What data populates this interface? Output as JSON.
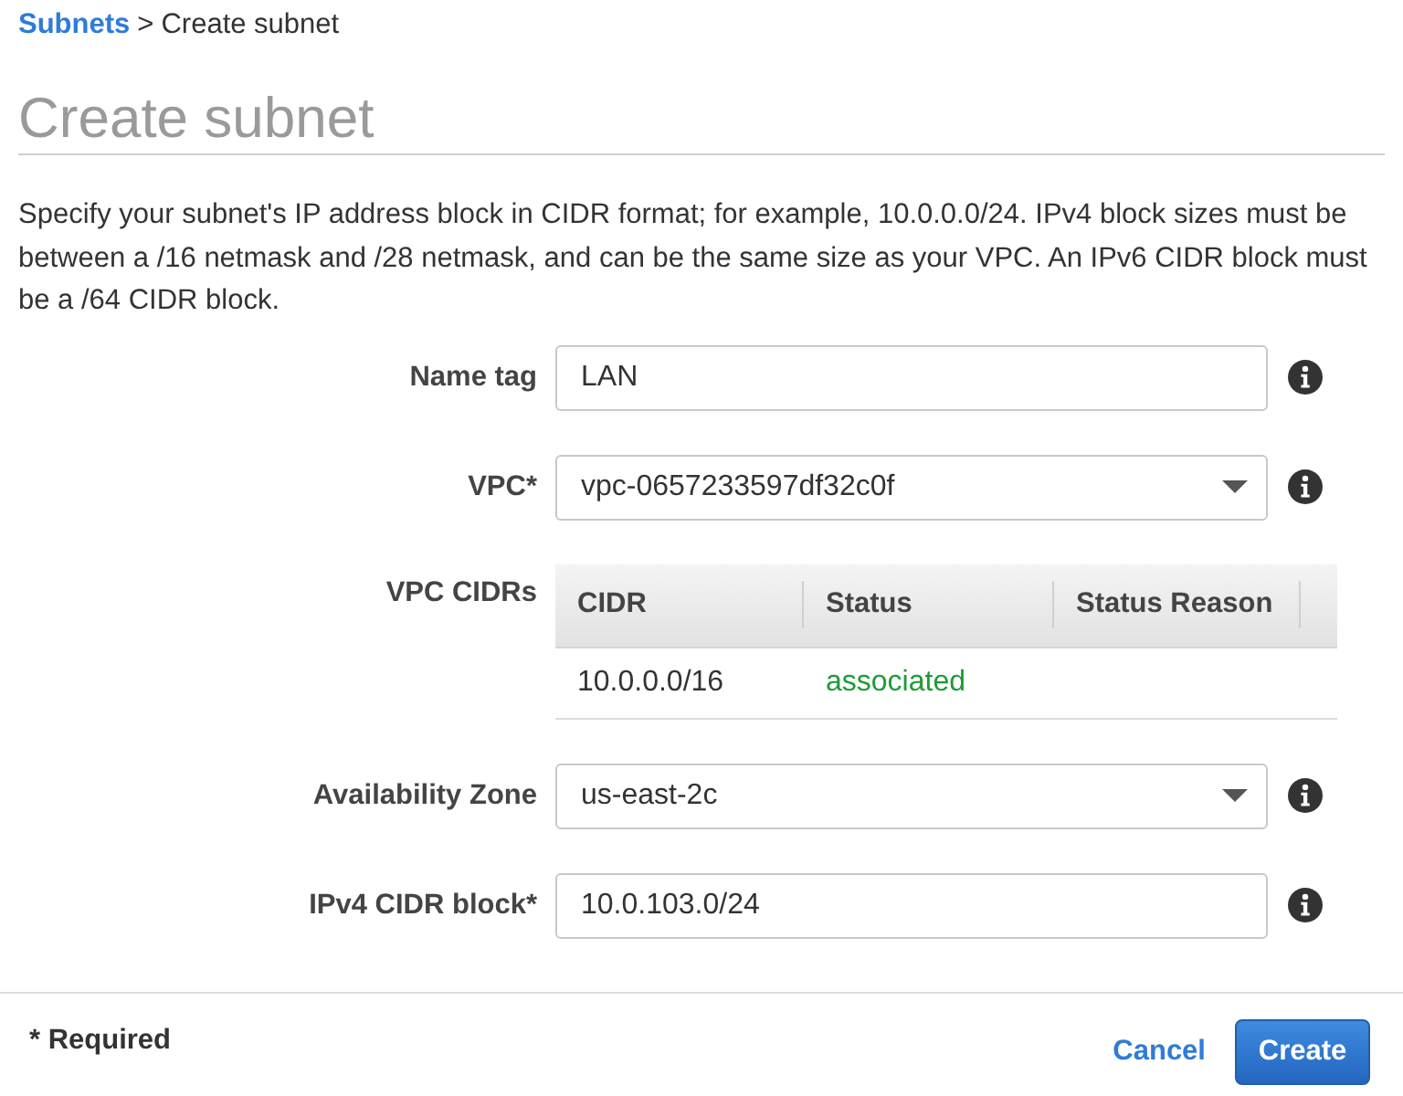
{
  "breadcrumb": {
    "items": [
      {
        "label": "Subnets",
        "kind": "link"
      },
      {
        "label": "Create subnet",
        "kind": "current"
      }
    ],
    "separator": ">"
  },
  "page_title": "Create subnet",
  "description": "Specify your subnet's IP address block in CIDR format; for example, 10.0.0.0/24. IPv4 block sizes must be between a /16 netmask and /28 netmask, and can be the same size as your VPC. An IPv6 CIDR block must be a /64 CIDR block.",
  "form": {
    "fields": [
      {
        "label": "Name tag",
        "kind": "text",
        "value": "LAN"
      },
      {
        "label": "VPC*",
        "kind": "select",
        "value": "vpc-0657233597df32c0f"
      },
      {
        "label": "VPC CIDRs",
        "kind": "table",
        "columns": [
          "CIDR",
          "Status",
          "Status Reason"
        ],
        "rows": [
          {
            "cidr": "10.0.0.0/16",
            "status": "associated"
          }
        ]
      },
      {
        "label": "Availability Zone",
        "kind": "select",
        "value": "us-east-2c"
      },
      {
        "label": "IPv4 CIDR block*",
        "kind": "text",
        "value": "10.0.103.0/24"
      }
    ]
  },
  "footer": {
    "note": "* Required",
    "buttons": [
      {
        "label": "Cancel",
        "kind": "link"
      },
      {
        "label": "Create",
        "kind": "primary"
      }
    ]
  }
}
